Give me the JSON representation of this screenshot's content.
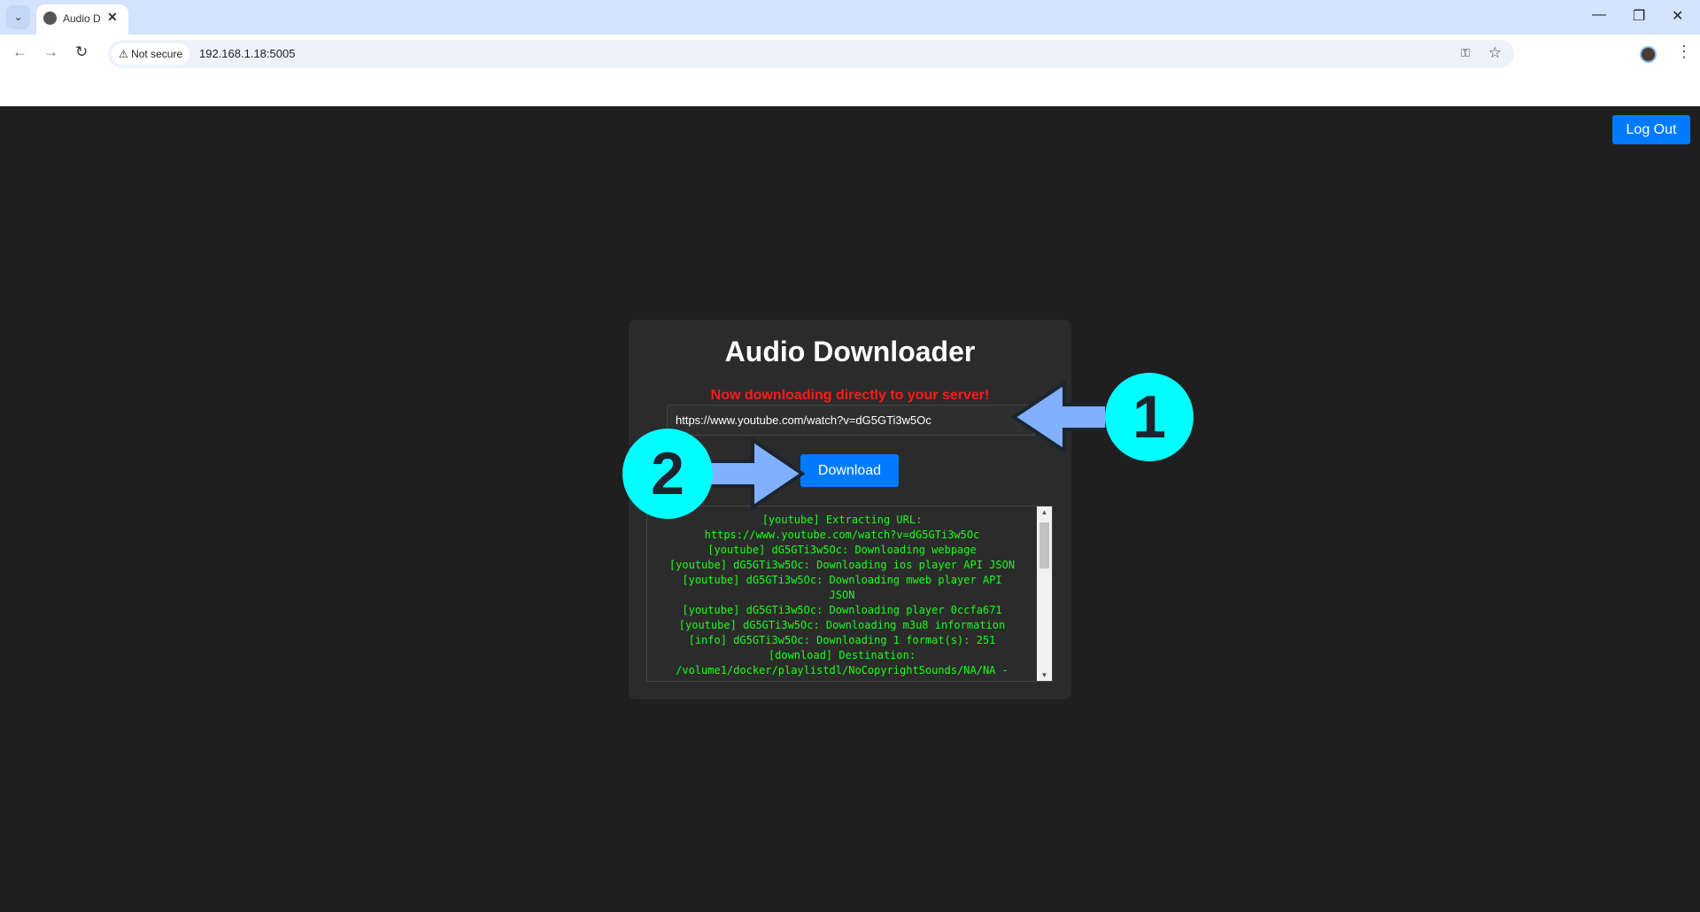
{
  "browser": {
    "tab_title": "Audio Downloader",
    "tab_title_visible": "Audio D",
    "security_label": "Not secure",
    "url": "192.168.1.18:5005"
  },
  "page": {
    "logout_label": "Log Out",
    "title": "Audio Downloader",
    "notice": "Now downloading directly to your server!",
    "notice_color": "#ff1a1a",
    "url_value": "https://www.youtube.com/watch?v=dG5GTi3w5Oc",
    "download_label": "Download",
    "accent_color": "#007bff",
    "log_lines": [
      "[youtube] Extracting URL:",
      "https://www.youtube.com/watch?v=dG5GTi3w5Oc",
      "[youtube] dG5GTi3w5Oc: Downloading webpage",
      "[youtube] dG5GTi3w5Oc: Downloading ios player API JSON",
      "[youtube] dG5GTi3w5Oc: Downloading mweb player API",
      "JSON",
      "[youtube] dG5GTi3w5Oc: Downloading player 0ccfa671",
      "[youtube] dG5GTi3w5Oc: Downloading m3u8 information",
      "[info] dG5GTi3w5Oc: Downloading 1 format(s): 251",
      "[download] Destination:",
      "/volume1/docker/playlistdl/NoCopyrightSounds/NA/NA -"
    ]
  },
  "annotations": {
    "step1": "1",
    "step2": "2",
    "circle_color": "#00ffff",
    "arrow_color": "#80b0ff"
  }
}
